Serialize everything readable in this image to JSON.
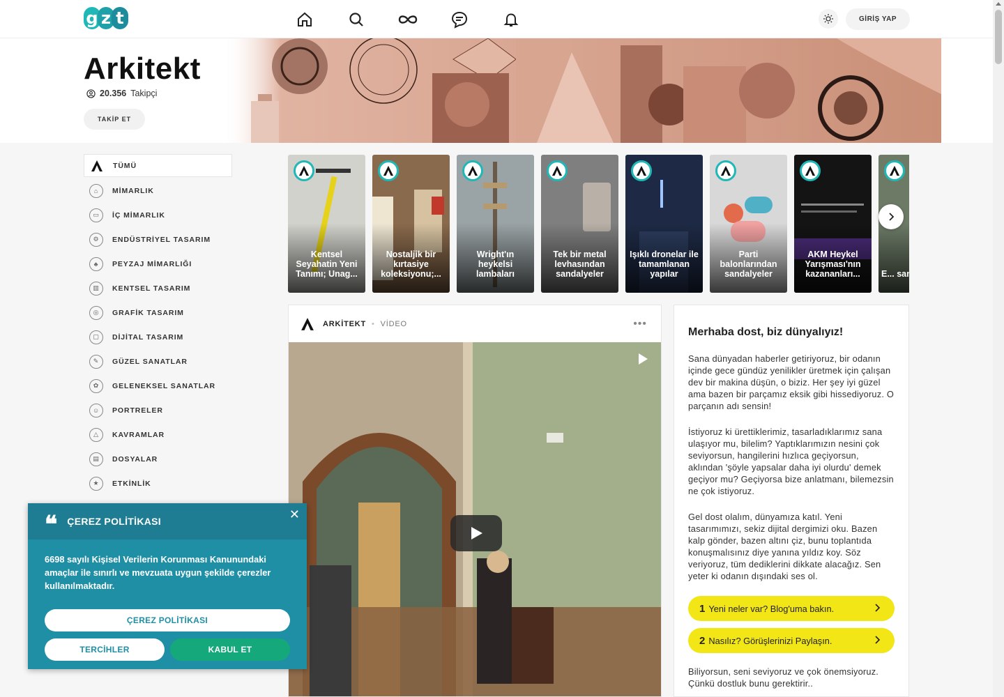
{
  "logo": {
    "letters": [
      "g",
      "z",
      "t"
    ]
  },
  "nav": {
    "icons": [
      "home-icon",
      "search-icon",
      "infinity-icon",
      "chat-icon",
      "bell-icon"
    ],
    "theme_icon": "sun-icon",
    "login_label": "GİRİŞ YAP"
  },
  "hero": {
    "title": "Arkitekt",
    "followers_count": "20.356",
    "followers_label": "Takipçi",
    "follow_label": "TAKİP ET"
  },
  "sidebar": {
    "items": [
      {
        "label": "TÜMÜ",
        "icon": "a-logo-icon",
        "active": true
      },
      {
        "label": "MİMARLIK",
        "icon": "architecture-icon"
      },
      {
        "label": "İÇ MİMARLIK",
        "icon": "interior-icon"
      },
      {
        "label": "ENDÜSTRİYEL TASARIM",
        "icon": "industrial-icon"
      },
      {
        "label": "PEYZAJ MİMARLIĞI",
        "icon": "landscape-icon"
      },
      {
        "label": "KENTSEL TASARIM",
        "icon": "urban-icon"
      },
      {
        "label": "GRAFİK TASARIM",
        "icon": "graphic-icon"
      },
      {
        "label": "DİJİTAL TASARIM",
        "icon": "digital-icon"
      },
      {
        "label": "GÜZEL SANATLAR",
        "icon": "fine-arts-icon"
      },
      {
        "label": "GELENEKSEL SANATLAR",
        "icon": "traditional-icon"
      },
      {
        "label": "PORTRELER",
        "icon": "portrait-icon"
      },
      {
        "label": "KAVRAMLAR",
        "icon": "concepts-icon"
      },
      {
        "label": "DOSYALAR",
        "icon": "files-icon"
      },
      {
        "label": "ETKİNLİK",
        "icon": "event-icon"
      }
    ]
  },
  "stories": [
    {
      "title": "Kentsel Seyahatin Yeni Tanımı; Unag...",
      "bg": "#c9c9c4",
      "accent": "#e6d21a"
    },
    {
      "title": "Nostaljik bir kırtasiye koleksiyonu;...",
      "bg": "#8a6a4c",
      "accent": "#c0392b"
    },
    {
      "title": "Wright'ın heykelsi lambaları",
      "bg": "#9aa3a5",
      "accent": "#6b5a48"
    },
    {
      "title": "Tek bir metal levhasından sandalyeler",
      "bg": "#7f7f80",
      "accent": "#b9b1a7"
    },
    {
      "title": "Işıklı dronelar ile tamamlanan yapılar",
      "bg": "#1e2a45",
      "accent": "#5f7fbf"
    },
    {
      "title": "Parti balonlarından sandalyeler",
      "bg": "#d8d8d8",
      "accent": "#e26b4c"
    },
    {
      "title": "AKM Heykel Yarışması'nın kazananları...",
      "bg": "#141414",
      "accent": "#4b2c7a"
    },
    {
      "title": "E... sant... s...",
      "bg": "#6c7a66",
      "accent": "#a9b39a"
    }
  ],
  "stories_next_icon": "chevron-right-icon",
  "post": {
    "author": "ARKİTEKT",
    "type": "VİDEO",
    "more_icon": "more-dots-icon",
    "play_icon": "play-icon"
  },
  "panel": {
    "title": "Merhaba dost, biz dünyalıyız!",
    "p1": "Sana dünyadan haberler getiriyoruz, bir odanın içinde gece gündüz yenilikler üretmek için çalışan dev bir makina düşün, o biziz. Her şey iyi güzel ama bazen bir parçamız eksik gibi hissediyoruz. O parçanın adı sensin!",
    "p2": "İstiyoruz ki ürettiklerimiz, tasarladıklarımız sana ulaşıyor mu, bilelim? Yaptıklarımızın nesini çok seviyorsun, hangilerini hızlıca geçiyorsun, aklından 'şöyle yapsalar daha iyi olurdu' demek geçiyor mu? Geçiyorsa bize anlatmanı, bilemezsin ne çok istiyoruz.",
    "p3": "Gel dost olalım, dünyamıza katıl. Yeni tasarımımızı, sekiz dijital dergimizi oku. Bazen kalp gönder, bazen altını çiz, bunu toplantıda konuşmalısınız diye yanına yıldız koy. Söz veriyoruz, tüm dediklerini dikkate alacağız. Sen yeter ki odanın dışındaki ses ol.",
    "links": [
      {
        "num": "1",
        "label": "Yeni neler var? Blog'uma bakın."
      },
      {
        "num": "2",
        "label": "Nasılız? Görüşlerinizi Paylaşın."
      }
    ],
    "p4": "Biliyorsun, seni seviyoruz ve çok önemsiyoruz. Çünkü dostluk bunu gerektirir.."
  },
  "cookie": {
    "title": "ÇEREZ POLİTİKASI",
    "quote_mark": "❝",
    "text": "6698 sayılı Kişisel Verilerin Korunması Kanunundaki amaçlar ile sınırlı ve mevzuata uygun şekilde çerezler kullanılmaktadır.",
    "policy_label": "ÇEREZ POLİTİKASI",
    "prefs_label": "TERCİHLER",
    "accept_label": "KABUL ET",
    "close_label": "✕"
  }
}
